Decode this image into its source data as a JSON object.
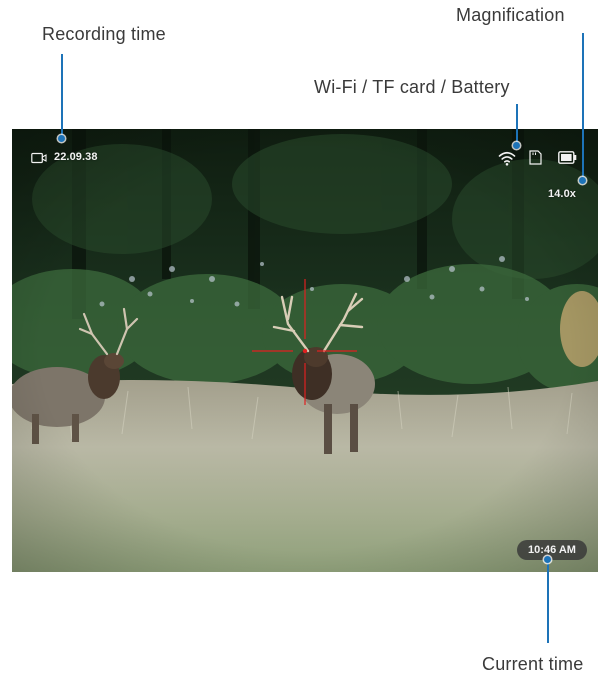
{
  "annotations": {
    "recording_time": "Recording time",
    "status_icons": "Wi-Fi / TF card / Battery",
    "magnification": "Magnification",
    "current_time": "Current time"
  },
  "osd": {
    "recording_time": "22.09.38",
    "magnification": "14.0x",
    "current_time": "10:46 AM",
    "icons": {
      "recording": "video-camera-icon",
      "wifi": "wifi-icon",
      "tf_card": "sd-card-icon",
      "battery": "battery-icon",
      "reticle": "crosshair-reticle"
    }
  },
  "colors": {
    "leader_line": "#1d73b8",
    "reticle": "#e02020",
    "osd_text": "#f2f2f2",
    "clock_background": "#373737"
  }
}
